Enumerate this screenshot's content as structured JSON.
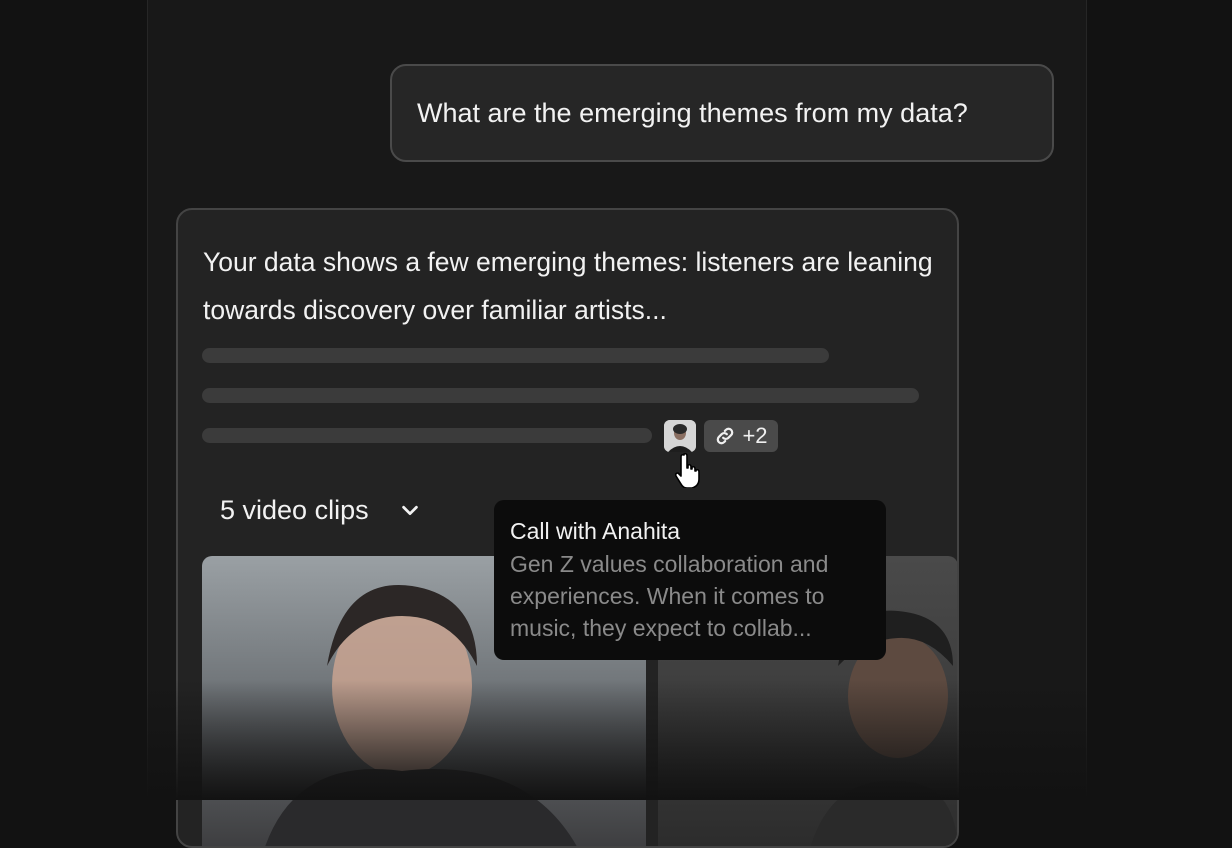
{
  "chat": {
    "user_message": "What are the emerging themes from my data?",
    "answer": {
      "text": "Your data shows a few emerging themes: listeners are leaning towards discovery over familiar artists...",
      "citations": {
        "avatar_icon": "person-avatar-icon",
        "link_icon": "link-icon",
        "extra_count": "+2"
      },
      "clips": {
        "label": "5 video clips",
        "chevron_icon": "chevron-down-icon"
      }
    },
    "tooltip": {
      "title": "Call with Anahita",
      "body": "Gen Z values collaboration and experiences. When it comes to music, they expect to collab..."
    }
  },
  "colors": {
    "background": "#121212",
    "card": "#232323",
    "bubble_border": "#4a4a4a",
    "text": "#f2f2f2",
    "muted_text": "#8a8a8a"
  }
}
